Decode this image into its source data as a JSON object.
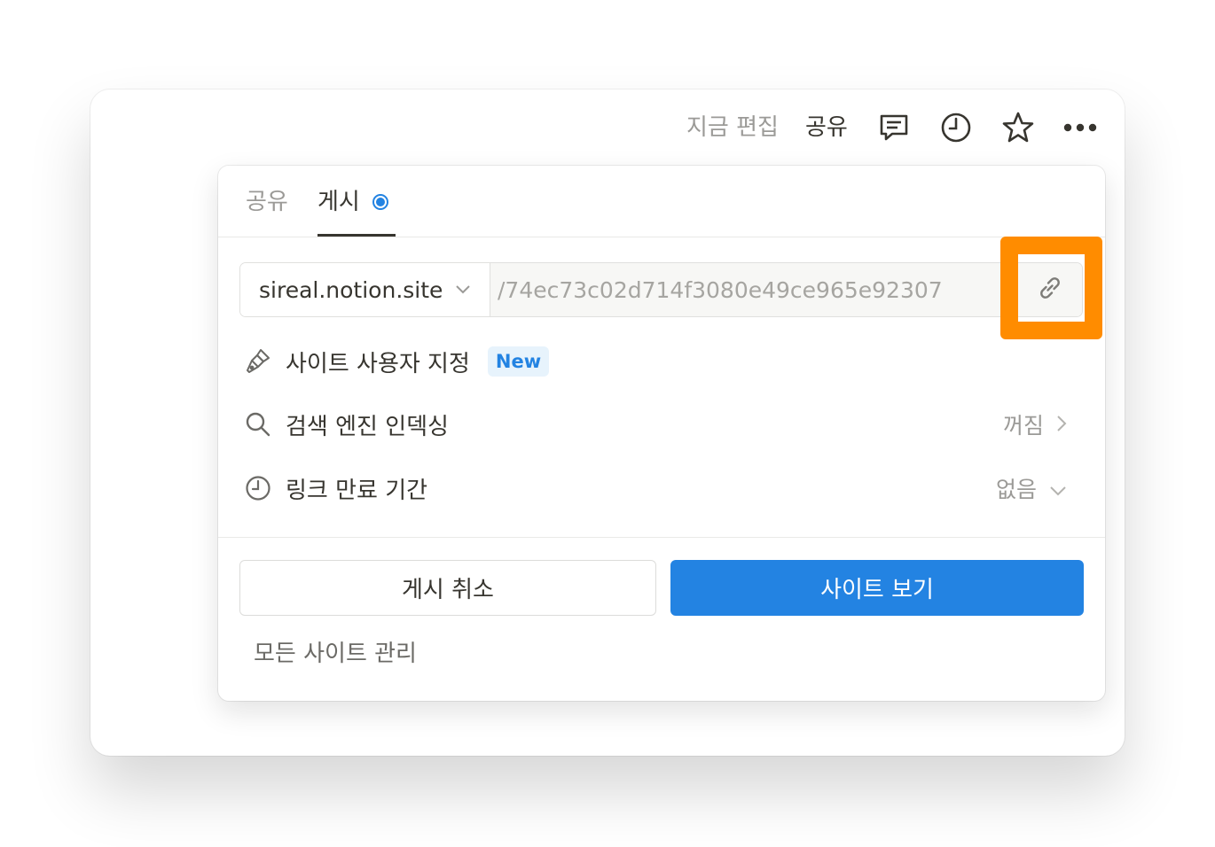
{
  "topbar": {
    "editing_label": "지금 편집",
    "share_label": "공유",
    "icons": [
      "comment-icon",
      "history-clock-icon",
      "star-icon",
      "more-icon"
    ]
  },
  "popover": {
    "tabs": [
      {
        "label": "공유",
        "active": false
      },
      {
        "label": "게시",
        "active": true
      }
    ],
    "url": {
      "domain": "sireal.notion.site",
      "path": "/74ec73c02d714f3080e49ce965e92307"
    },
    "options": [
      {
        "label": "사이트 사용자 지정",
        "badge": "New",
        "icon": "paintbrush-icon"
      },
      {
        "label": "검색 엔진 인덱싱",
        "value": "꺼짐",
        "icon": "search-icon"
      },
      {
        "label": "링크 만료 기간",
        "value": "없음",
        "icon": "clock-icon"
      }
    ],
    "buttons": {
      "unpublish": "게시 취소",
      "view_site": "사이트 보기"
    },
    "manage_link": "모든 사이트 관리"
  },
  "colors": {
    "accent": "#2383e2",
    "highlight": "#ff8c00",
    "text": "#37352f",
    "muted": "#9b9a97"
  }
}
